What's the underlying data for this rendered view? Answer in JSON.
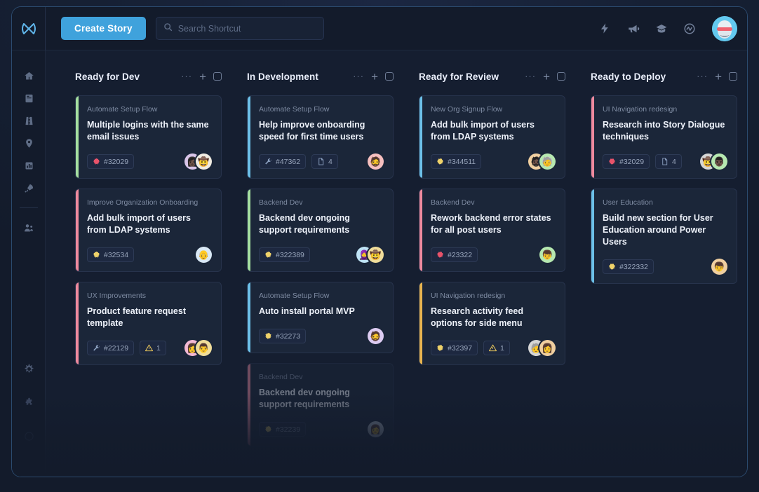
{
  "app": {
    "logo_name": "shortcut-logo",
    "create_story_label": "Create Story",
    "search_placeholder": "Search Shortcut",
    "search_value": ""
  },
  "topbar_icons": [
    {
      "name": "lightning-icon",
      "label": "Automations"
    },
    {
      "name": "megaphone-icon",
      "label": "Announcements"
    },
    {
      "name": "graduation-cap-icon",
      "label": "Learn"
    },
    {
      "name": "activity-pulse-icon",
      "label": "Activity"
    }
  ],
  "rail": {
    "items": [
      {
        "name": "home-icon",
        "label": "Home"
      },
      {
        "name": "book-icon",
        "label": "Docs"
      },
      {
        "name": "road-icon",
        "label": "Roadmap"
      },
      {
        "name": "location-pin-icon",
        "label": "Milestones"
      },
      {
        "name": "chart-icon",
        "label": "Reports"
      },
      {
        "name": "rocket-icon",
        "label": "Iterations"
      },
      {
        "name": "people-icon",
        "label": "Teams"
      }
    ],
    "bottom_items": [
      {
        "name": "gear-icon",
        "label": "Settings"
      },
      {
        "name": "puzzle-icon",
        "label": "Integrations"
      },
      {
        "name": "help-circle-icon",
        "label": "Help"
      }
    ]
  },
  "board": {
    "column_actions": {
      "more_label": "···",
      "add_label": "+",
      "select_name": "column-select-checkbox"
    },
    "columns": [
      {
        "title": "Ready for Dev",
        "cards": [
          {
            "epic": "Automate Setup Flow",
            "title": "Multiple logins with the same email issues",
            "accent": "#a5dfa0",
            "badges": [
              {
                "icon": "bug-icon",
                "color": "#e8536a",
                "text": "#32029"
              }
            ],
            "avatars": [
              {
                "bg": "#d8c4e8",
                "glyph": "👩🏿"
              },
              {
                "bg": "#f0ece2",
                "glyph": "🤠"
              }
            ],
            "ghost": false
          },
          {
            "epic": "Improve Organization Onboarding",
            "title": "Add bulk import of users from LDAP systems",
            "accent": "#ef8a9e",
            "badges": [
              {
                "icon": "feature-icon",
                "color": "#efd26a",
                "text": "#32534"
              }
            ],
            "avatars": [
              {
                "bg": "#d9e8f5",
                "glyph": "👴"
              }
            ],
            "ghost": false
          },
          {
            "epic": "UX Improvements",
            "title": "Product feature request template",
            "accent": "#ef8a9e",
            "badges": [
              {
                "icon": "chore-icon",
                "color": "#8fa4c4",
                "text": "#22129"
              },
              {
                "icon": "warning-icon",
                "color": "#e8c55a",
                "text": "1"
              }
            ],
            "avatars": [
              {
                "bg": "#f3b8d4",
                "glyph": "👩"
              },
              {
                "bg": "#f0dd9a",
                "glyph": "👨"
              }
            ],
            "ghost": false
          }
        ]
      },
      {
        "title": "In Development",
        "cards": [
          {
            "epic": "Automate Setup Flow",
            "title": "Help improve onboarding speed for first time users",
            "accent": "#6cc0e8",
            "badges": [
              {
                "icon": "chore-icon",
                "color": "#8fa4c4",
                "text": "#47362"
              },
              {
                "icon": "doc-icon",
                "color": "#8fa4c4",
                "text": "4"
              }
            ],
            "avatars": [
              {
                "bg": "#f6bfbf",
                "glyph": "🧔"
              }
            ],
            "ghost": false
          },
          {
            "epic": "Backend Dev",
            "title": "Backend dev ongoing support requirements",
            "accent": "#a5dfa0",
            "badges": [
              {
                "icon": "feature-icon",
                "color": "#efd26a",
                "text": "#322389"
              }
            ],
            "avatars": [
              {
                "bg": "#bfe3f5",
                "glyph": "🧕"
              },
              {
                "bg": "#f0dd9a",
                "glyph": "🤠"
              }
            ],
            "ghost": false
          },
          {
            "epic": "Automate Setup Flow",
            "title": "Auto install portal MVP",
            "accent": "#6cc0e8",
            "badges": [
              {
                "icon": "feature-icon",
                "color": "#efd26a",
                "text": "#32273"
              }
            ],
            "avatars": [
              {
                "bg": "#ddccf2",
                "glyph": "🧔"
              }
            ],
            "ghost": false
          },
          {
            "epic": "Backend Dev",
            "title": "Backend dev ongoing support requirements",
            "accent": "#ef8a9e",
            "badges": [
              {
                "icon": "feature-icon",
                "color": "#efd26a",
                "text": "#32239"
              }
            ],
            "avatars": [
              {
                "bg": "#cfdbe8",
                "glyph": "👩"
              }
            ],
            "ghost": true
          }
        ]
      },
      {
        "title": "Ready for Review",
        "cards": [
          {
            "epic": "New Org Signup Flow",
            "title": "Add bulk import of users from LDAP systems",
            "accent": "#6cc0e8",
            "badges": [
              {
                "icon": "feature-icon",
                "color": "#efd26a",
                "text": "#344511"
              }
            ],
            "avatars": [
              {
                "bg": "#f0cfa0",
                "glyph": "🧔🏿"
              },
              {
                "bg": "#b6e8b0",
                "glyph": "🧓"
              }
            ],
            "ghost": false
          },
          {
            "epic": "Backend Dev",
            "title": "Rework backend error states for all post users",
            "accent": "#ef8a9e",
            "badges": [
              {
                "icon": "bug-icon",
                "color": "#e8536a",
                "text": "#23322"
              }
            ],
            "avatars": [
              {
                "bg": "#b6e8b0",
                "glyph": "👦"
              }
            ],
            "ghost": false
          },
          {
            "epic": "UI Navigation redesign",
            "title": "Research activity feed options for side menu",
            "accent": "#e8b44f",
            "badges": [
              {
                "icon": "feature-icon",
                "color": "#efd26a",
                "text": "#32397"
              },
              {
                "icon": "warning-icon",
                "color": "#e8c55a",
                "text": "1"
              }
            ],
            "avatars": [
              {
                "bg": "#d6d6d6",
                "glyph": "🧓"
              },
              {
                "bg": "#f0cfa0",
                "glyph": "👩"
              }
            ],
            "ghost": false
          }
        ]
      },
      {
        "title": "Ready to Deploy",
        "cards": [
          {
            "epic": "UI Navigation redesign",
            "title": "Research into Story Dialogue techniques",
            "accent": "#ef8a9e",
            "badges": [
              {
                "icon": "bug-icon",
                "color": "#e8536a",
                "text": "#32029"
              },
              {
                "icon": "doc-icon",
                "color": "#8fa4c4",
                "text": "4"
              }
            ],
            "avatars": [
              {
                "bg": "#d6d6d6",
                "glyph": "🤠"
              },
              {
                "bg": "#b6e8b0",
                "glyph": "👨🏿"
              }
            ],
            "ghost": false
          },
          {
            "epic": "User Education",
            "title": "Build new section for User Education around Power Users",
            "accent": "#6cc0e8",
            "badges": [
              {
                "icon": "feature-icon",
                "color": "#efd26a",
                "text": "#322332"
              }
            ],
            "avatars": [
              {
                "bg": "#f0cfa0",
                "glyph": "👦"
              }
            ],
            "ghost": false
          }
        ]
      }
    ]
  }
}
